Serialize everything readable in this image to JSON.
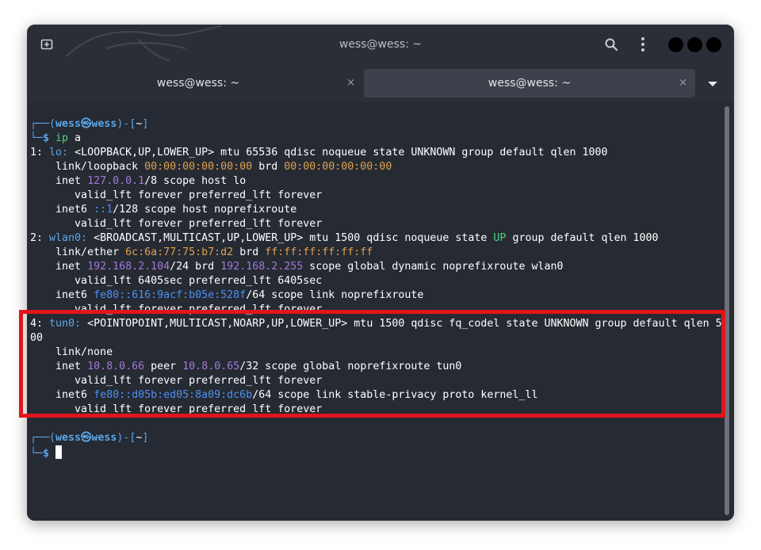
{
  "window": {
    "title": "wess@wess: ~"
  },
  "tabs": [
    {
      "label": "wess@wess: ~",
      "close": "×",
      "active": false
    },
    {
      "label": "wess@wess: ~",
      "close": "×",
      "active": true
    }
  ],
  "icons": {
    "new_tab": "new-tab-icon",
    "search": "search-icon",
    "menu": "kebab-menu-icon",
    "tabs_dropdown": "chevron-down-icon"
  },
  "colors": {
    "prompt_blue": "#5aa6e8",
    "hex_orange": "#e0a04a",
    "ip_purple": "#a27ad6",
    "ipv6_blue": "#4d90f0",
    "state_up_green": "#4bd37c",
    "highlight_red": "#e3141b"
  },
  "terminal": {
    "lines": [
      [
        {
          "t": "┌──(",
          "c": "c-b"
        },
        {
          "t": "wess㉿wess",
          "c": "c-bb"
        },
        {
          "t": ")-[",
          "c": "c-b"
        },
        {
          "t": "~",
          "c": "c-w"
        },
        {
          "t": "]",
          "c": "c-b"
        }
      ],
      [
        {
          "t": "└─",
          "c": "c-b"
        },
        {
          "t": "$ ",
          "c": "c-bb"
        },
        {
          "t": "ip",
          "c": "c-g"
        },
        {
          "t": " a",
          "c": "c-w"
        }
      ],
      [
        {
          "t": "1: ",
          "c": "c-w"
        },
        {
          "t": "lo: ",
          "c": "c-b"
        },
        {
          "t": "<LOOPBACK,UP,LOWER_UP> mtu 65536 qdisc noqueue state UNKNOWN group default qlen 1000",
          "c": "c-w"
        }
      ],
      [
        {
          "t": "    link/loopback ",
          "c": "c-w"
        },
        {
          "t": "00:00:00:00:00:00",
          "c": "c-o"
        },
        {
          "t": " brd ",
          "c": "c-w"
        },
        {
          "t": "00:00:00:00:00:00",
          "c": "c-o"
        }
      ],
      [
        {
          "t": "    inet ",
          "c": "c-w"
        },
        {
          "t": "127.0.0.1",
          "c": "c-p"
        },
        {
          "t": "/8 scope host lo",
          "c": "c-w"
        }
      ],
      [
        {
          "t": "       valid_lft forever preferred_lft forever",
          "c": "c-w"
        }
      ],
      [
        {
          "t": "    inet6 ",
          "c": "c-w"
        },
        {
          "t": "::1",
          "c": "c-bl"
        },
        {
          "t": "/128 scope host noprefixroute",
          "c": "c-w"
        }
      ],
      [
        {
          "t": "       valid_lft forever preferred_lft forever",
          "c": "c-w"
        }
      ],
      [
        {
          "t": "2: ",
          "c": "c-w"
        },
        {
          "t": "wlan0: ",
          "c": "c-b"
        },
        {
          "t": "<BROADCAST,MULTICAST,UP,LOWER_UP> mtu 1500 qdisc noqueue state ",
          "c": "c-w"
        },
        {
          "t": "UP",
          "c": "c-g"
        },
        {
          "t": " group default qlen 1000",
          "c": "c-w"
        }
      ],
      [
        {
          "t": "    link/ether ",
          "c": "c-w"
        },
        {
          "t": "6c:6a:77:75:b7:d2",
          "c": "c-o"
        },
        {
          "t": " brd ",
          "c": "c-w"
        },
        {
          "t": "ff:ff:ff:ff:ff:ff",
          "c": "c-o"
        }
      ],
      [
        {
          "t": "    inet ",
          "c": "c-w"
        },
        {
          "t": "192.168.2.104",
          "c": "c-p"
        },
        {
          "t": "/24 brd ",
          "c": "c-w"
        },
        {
          "t": "192.168.2.255",
          "c": "c-p"
        },
        {
          "t": " scope global dynamic noprefixroute wlan0",
          "c": "c-w"
        }
      ],
      [
        {
          "t": "       valid_lft 6405sec preferred_lft 6405sec",
          "c": "c-w"
        }
      ],
      [
        {
          "t": "    inet6 ",
          "c": "c-w"
        },
        {
          "t": "fe80::616:9acf:b05e:528f",
          "c": "c-bl"
        },
        {
          "t": "/64 scope link noprefixroute",
          "c": "c-w"
        }
      ],
      [
        {
          "t": "       valid_lft forever preferred_lft forever",
          "c": "c-w"
        }
      ],
      [
        {
          "t": "4: ",
          "c": "c-w"
        },
        {
          "t": "tun0: ",
          "c": "c-b"
        },
        {
          "t": "<POINTOPOINT,MULTICAST,NOARP,UP,LOWER_UP> mtu 1500 qdisc fq_codel state UNKNOWN group default qlen 5",
          "c": "c-w"
        }
      ],
      [
        {
          "t": "00",
          "c": "c-w"
        }
      ],
      [
        {
          "t": "    link/none",
          "c": "c-w"
        }
      ],
      [
        {
          "t": "    inet ",
          "c": "c-w"
        },
        {
          "t": "10.8.0.66",
          "c": "c-p"
        },
        {
          "t": " peer ",
          "c": "c-w"
        },
        {
          "t": "10.8.0.65",
          "c": "c-p"
        },
        {
          "t": "/32 scope global noprefixroute tun0",
          "c": "c-w"
        }
      ],
      [
        {
          "t": "       valid_lft forever preferred_lft forever",
          "c": "c-w"
        }
      ],
      [
        {
          "t": "    inet6 ",
          "c": "c-w"
        },
        {
          "t": "fe80::d05b:ed05:8a09:dc6b",
          "c": "c-bl"
        },
        {
          "t": "/64 scope link stable-privacy proto kernel_ll",
          "c": "c-w"
        }
      ],
      [
        {
          "t": "       valid_lft forever preferred_lft forever",
          "c": "c-w"
        }
      ],
      [
        {
          "t": "",
          "c": "c-w"
        }
      ],
      [
        {
          "t": "┌──(",
          "c": "c-b"
        },
        {
          "t": "wess㉿wess",
          "c": "c-bb"
        },
        {
          "t": ")-[",
          "c": "c-b"
        },
        {
          "t": "~",
          "c": "c-w"
        },
        {
          "t": "]",
          "c": "c-b"
        }
      ],
      [
        {
          "t": "└─",
          "c": "c-b"
        },
        {
          "t": "$ ",
          "c": "c-bb"
        }
      ]
    ]
  }
}
